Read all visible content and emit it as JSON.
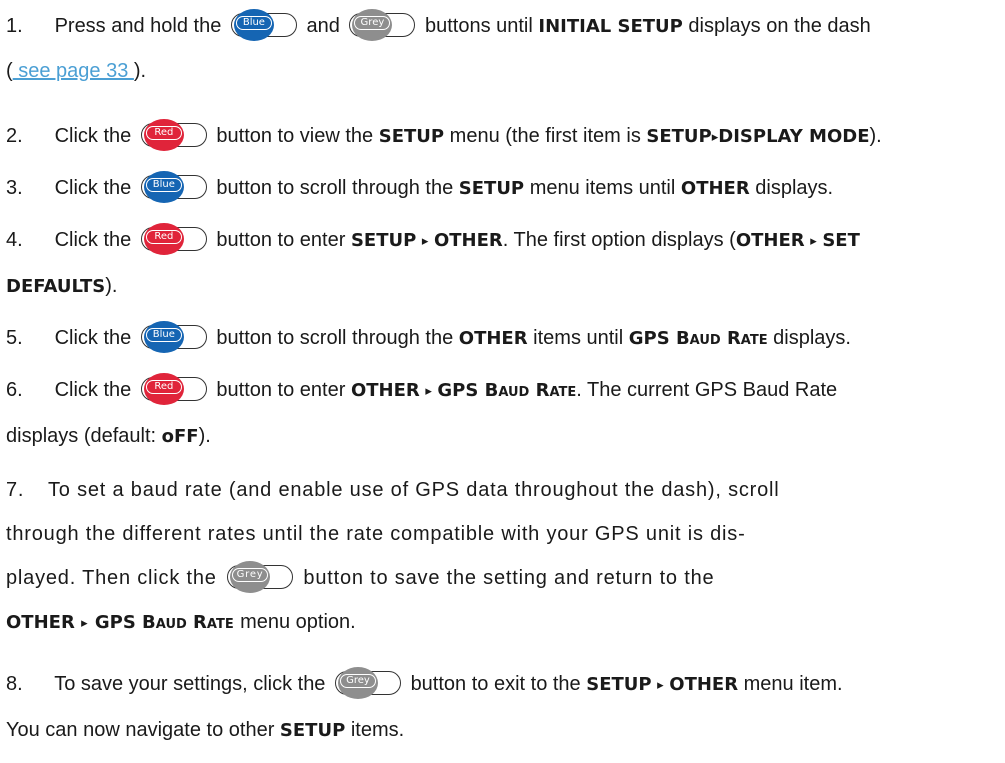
{
  "steps": [
    {
      "num": "1.",
      "parts": {
        "a": "Press and hold the",
        "btn1": "Blue",
        "and": "and",
        "btn2": "Grey",
        "b": "buttons until",
        "kw1": "INITIAL SETUP",
        "c": "displays on the dash",
        "open": "(",
        "link": " see page 33 ",
        "close": ")."
      }
    },
    {
      "num": "2.",
      "parts": {
        "a": "Click the",
        "btn1": "Red",
        "b": "button to view the",
        "kw1": "SETUP",
        "c": "menu (the first item is",
        "kw2": "SETUP",
        "kw3": "DISPLAY MODE",
        "d": ")."
      }
    },
    {
      "num": "3.",
      "parts": {
        "a": "Click the",
        "btn1": "Blue",
        "b": "button to scroll through the",
        "kw1": "SETUP",
        "c": "menu items until",
        "kw2": "OTHER",
        "d": "displays."
      }
    },
    {
      "num": "4.",
      "parts": {
        "a": "Click the",
        "btn1": "Red",
        "b": "button to enter",
        "kw1": "SETUP",
        "kw2": "OTHER",
        "c": ". The first option displays (",
        "kw3": "OTHER",
        "kw4": "SET",
        "kw5": "DEFAULTS",
        "d": ")."
      }
    },
    {
      "num": "5.",
      "parts": {
        "a": "Click the",
        "btn1": "Blue",
        "b": "button to scroll through the",
        "kw1": "OTHER",
        "c": "items until",
        "kw2": "GPS Baud Rate",
        "d": "displays."
      }
    },
    {
      "num": "6.",
      "parts": {
        "a": "Click the",
        "btn1": "Red",
        "b": "button to enter",
        "kw1": "OTHER",
        "kw2": "GPS Baud Rate",
        "c": ". The current GPS Baud Rate",
        "d": "displays (default:",
        "kw3": "oFF",
        "e": ")."
      }
    },
    {
      "num": "7.",
      "parts": {
        "a": "To set a baud rate (and enable use of GPS data throughout the dash), scroll",
        "b": "through the different rates until the rate compatible with your GPS unit  is dis-",
        "c": "played. Then click the",
        "btn1": "Grey",
        "d": "button to save the setting and return to the",
        "kw1": "OTHER",
        "kw2": "GPS Baud Rate",
        "e": "menu option."
      }
    },
    {
      "num": "8.",
      "parts": {
        "a": "To save your settings, click the",
        "btn1": "Grey",
        "b": "button to exit to the",
        "kw1": "SETUP",
        "kw2": "OTHER",
        "c": "menu item.",
        "d": "You can now navigate to other",
        "kw3": "SETUP",
        "e": "items."
      }
    }
  ],
  "arrow_glyph": "▸",
  "colors": {
    "blue": "#1565b3",
    "red": "#e0243a",
    "grey": "#8e8e8e",
    "link": "#4b9fd4"
  }
}
